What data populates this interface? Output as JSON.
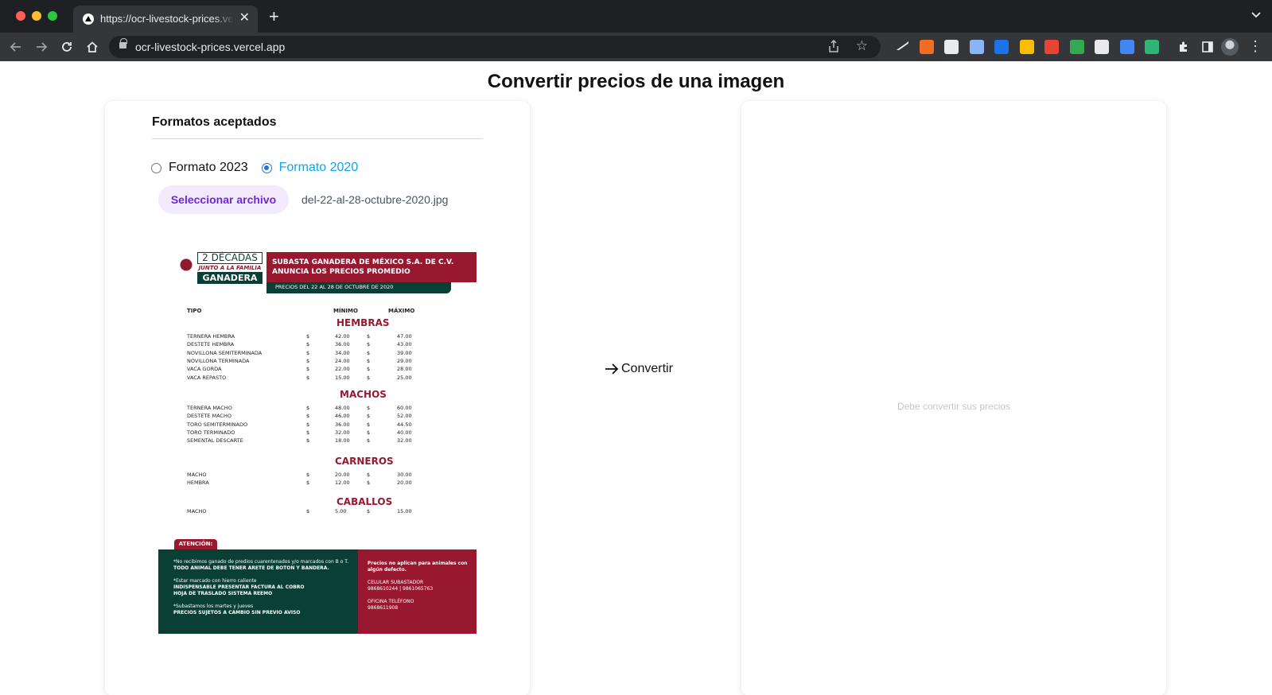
{
  "browser": {
    "tab_title": "https://ocr-livestock-prices.vercel.app",
    "tab_close": "✕",
    "new_tab": "+",
    "url": "ocr-livestock-prices.vercel.app",
    "icons": [
      "back-icon",
      "forward-icon",
      "reload-icon",
      "home-icon",
      "lock-icon",
      "share-icon",
      "star-icon",
      "extensions-icon",
      "sidebar-icon",
      "profile-avatar",
      "menu-icon"
    ],
    "extension_colors": [
      "#e8eaed",
      "#f06d22",
      "#e8eaed",
      "#8ab4f8",
      "#1a73e8",
      "#fbbc04",
      "#ea4335",
      "#34a853",
      "#e8eaed",
      "#4285f4",
      "#2bb673"
    ]
  },
  "page": {
    "title": "Convertir precios de una imagen",
    "section_title": "Formatos aceptados",
    "formats": [
      {
        "label": "Formato 2023",
        "checked": false
      },
      {
        "label": "Formato 2020",
        "checked": true
      }
    ],
    "file_button": "Seleccionar archivo",
    "file_name": "del-22-al-28-octubre-2020.jpg",
    "convert_label": "Convertir",
    "result_placeholder": "Debe convertir sus precios",
    "accent_color": "#0ea5e9",
    "button_color": "#6d28d9"
  },
  "flyer": {
    "logo": {
      "decadas": "2 DÉCADAS",
      "junto": "JUNTO A LA FAMILIA",
      "ganadera": "GANADERA"
    },
    "header_line1": "SUBASTA GANADERA DE MÉXICO S.A. DE C.V.",
    "header_line2": "ANUNCIA LOS PRECIOS PROMEDIO",
    "period": "PRECIOS DEL 22 AL 28 DE OCTUBRE  DE 2020",
    "col_tipo": "TIPO",
    "col_min": "MÍNIMO",
    "col_max": "MÁXIMO",
    "currency": "$",
    "sections": [
      {
        "name": "HEMBRAS",
        "rows": [
          {
            "tipo": "TERNERA HEMBRA",
            "min": "42.00",
            "max": "47.00"
          },
          {
            "tipo": "DESTETE HEMBRA",
            "min": "36.00",
            "max": "43.00"
          },
          {
            "tipo": "NOVILLONA SEMITERMINADA",
            "min": "34.00",
            "max": "39.00"
          },
          {
            "tipo": "NOVILLONA TERMINADA",
            "min": "24.00",
            "max": "29.00"
          },
          {
            "tipo": "VACA GORDA",
            "min": "22.00",
            "max": "28.00"
          },
          {
            "tipo": "VACA REPASTO",
            "min": "15.00",
            "max": "25.00"
          }
        ]
      },
      {
        "name": "MACHOS",
        "rows": [
          {
            "tipo": "TERNERA MACHO",
            "min": "48.00",
            "max": "60.00"
          },
          {
            "tipo": "DESTETE MACHO",
            "min": "46.00",
            "max": "52.00"
          },
          {
            "tipo": "TORO SEMITERMINADO",
            "min": "36.00",
            "max": "44.50"
          },
          {
            "tipo": "TORO TERMINADO",
            "min": "32.00",
            "max": "40.00"
          },
          {
            "tipo": "SEMENTAL DESCARTE",
            "min": "18.00",
            "max": "32.00"
          }
        ]
      },
      {
        "name": "CARNEROS",
        "rows": [
          {
            "tipo": "MACHO",
            "min": "20.00",
            "max": "30.00"
          },
          {
            "tipo": "HEMBRA",
            "min": "12.00",
            "max": "20.00"
          }
        ]
      },
      {
        "name": "CABALLOS",
        "rows": [
          {
            "tipo": "MACHO",
            "min": "5.00",
            "max": "15.00"
          }
        ]
      }
    ],
    "atencion": "ATENCIÓN:",
    "notes": {
      "n1a": "*No recibimos ganado de predios cuarentenados y/o marcados con B o T.",
      "n1b": "TODO ANIMAL DEBE TENER ARETE DE BOTON Y BANDERA.",
      "n2a": "*Estar marcado con hierro caliente",
      "n2b": "INDISPENSABLE PRESENTAR FACTURA AL COBRO",
      "n2c": "HOJA DE TRASLADO SISTEMA REEMO",
      "n3a": "*Subastamos los martes y jueves",
      "n3b": "PRECIOS SUJETOS A CAMBIO SIN PREVIO AVISO",
      "r1a": "Precios no aplican para animales con",
      "r1b": "algún defecto.",
      "r2a": "CELULAR SUBASTADOR",
      "r2b": "9868610244 | 9861065763",
      "r3a": "OFICINA TELÉFONO",
      "r3b": "9868611908"
    }
  }
}
